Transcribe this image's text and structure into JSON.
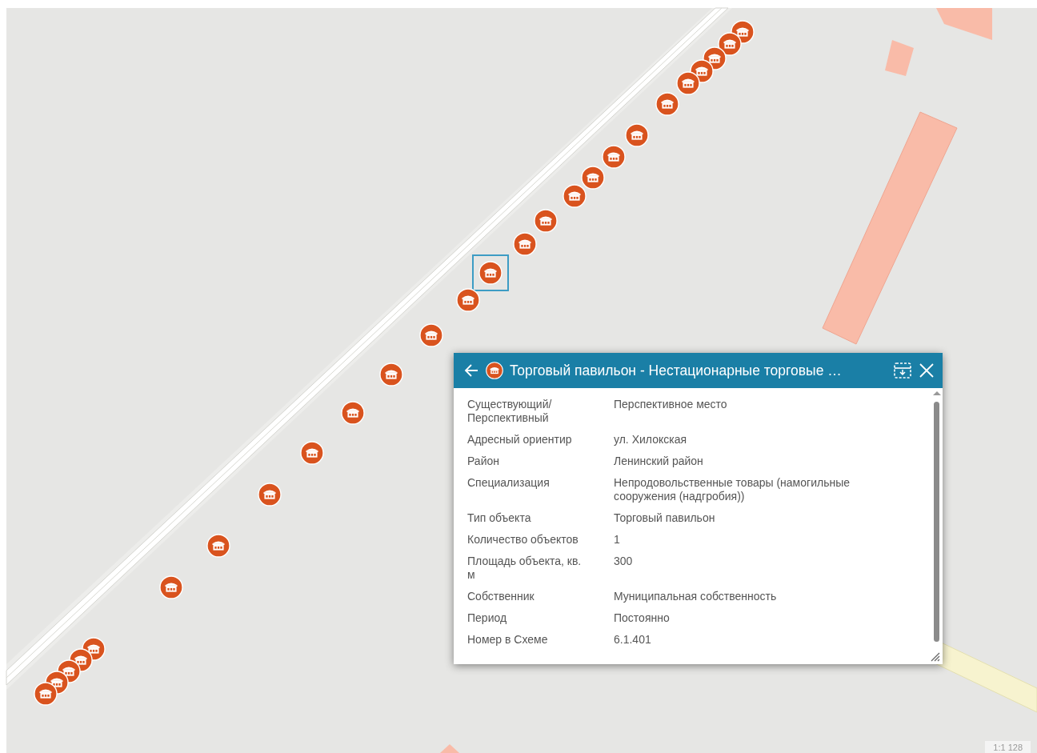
{
  "map": {
    "markers": [
      {
        "selected": false
      },
      {
        "selected": false
      },
      {
        "selected": false
      },
      {
        "selected": false
      },
      {
        "selected": false
      },
      {
        "selected": false
      },
      {
        "selected": false
      },
      {
        "selected": false
      },
      {
        "selected": false
      },
      {
        "selected": false
      },
      {
        "selected": false
      },
      {
        "selected": false
      },
      {
        "selected": true
      },
      {
        "selected": false
      },
      {
        "selected": false
      },
      {
        "selected": false
      },
      {
        "selected": false
      },
      {
        "selected": false
      },
      {
        "selected": false
      },
      {
        "selected": false
      },
      {
        "selected": false
      },
      {
        "selected": false
      },
      {
        "selected": false
      },
      {
        "selected": false
      },
      {
        "selected": false
      },
      {
        "selected": false
      }
    ],
    "scale": "1:1 128"
  },
  "popup": {
    "title": "Торговый павильон - Нестационарные торговые …",
    "fields": [
      {
        "label": "Существующий/ Перспективный",
        "value": "Перспективное место"
      },
      {
        "label": "Адресный ориентир",
        "value": "ул. Хилокская"
      },
      {
        "label": "Район",
        "value": "Ленинский район"
      },
      {
        "label": "Специализация",
        "value": "Непродовольственные товары (намогильные сооружения (надгробия))"
      },
      {
        "label": "Тип объекта",
        "value": "Торговый павильон"
      },
      {
        "label": "Количество объектов",
        "value": "1"
      },
      {
        "label": "Площадь объекта, кв. м",
        "value": "300"
      },
      {
        "label": "Собственник",
        "value": "Муниципальная собственность"
      },
      {
        "label": "Период",
        "value": "Постоянно"
      },
      {
        "label": "Номер в Схеме",
        "value": "6.1.401"
      }
    ]
  }
}
